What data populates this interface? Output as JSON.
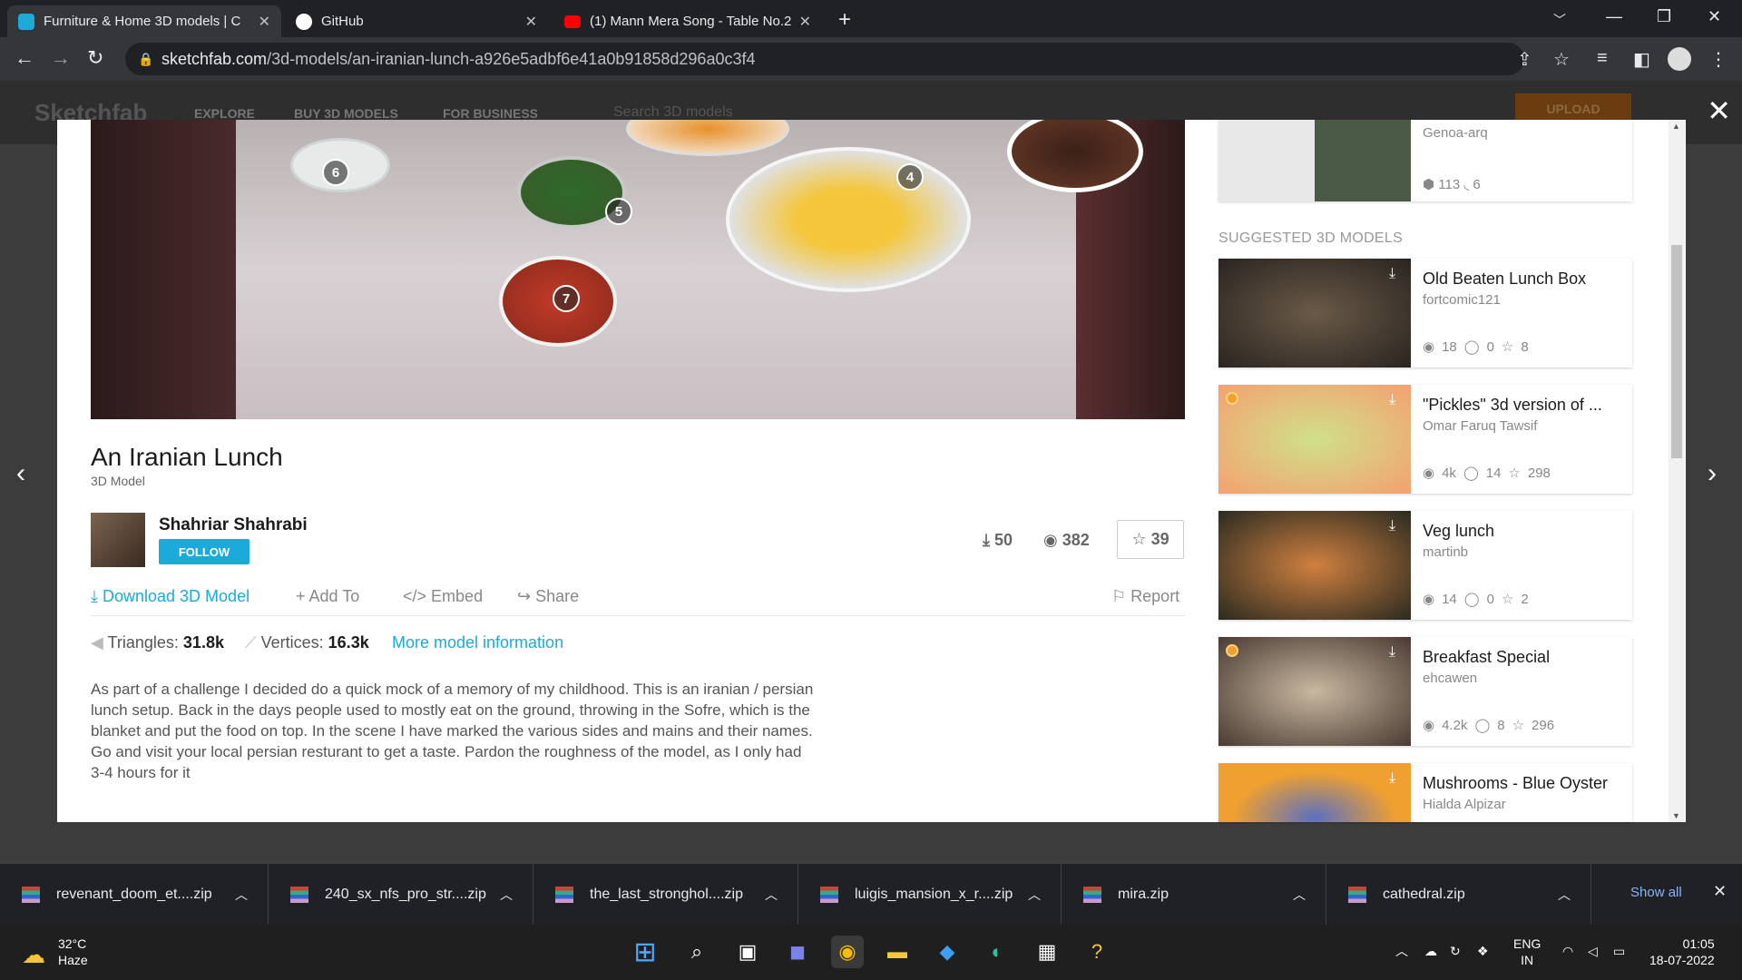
{
  "browser": {
    "tabs": [
      {
        "title": "Furniture & Home 3D models | C",
        "color": "#1caad9"
      },
      {
        "title": "GitHub",
        "color": "#ffffff"
      },
      {
        "title": "(1) Mann Mera Song - Table No.2",
        "color": "#ff0000"
      }
    ],
    "url_domain": "sketchfab.com",
    "url_path": "/3d-models/an-iranian-lunch-a926e5adbf6e41a0b91858d296a0c3f4"
  },
  "model": {
    "title": "An Iranian Lunch",
    "type": "3D Model",
    "author": "Shahriar Shahrabi",
    "follow_label": "FOLLOW",
    "downloads": "50",
    "views": "382",
    "likes": "39",
    "hotspots": [
      "6",
      "5",
      "4",
      "7"
    ],
    "actions": {
      "download": "Download 3D Model",
      "add_to": "Add To",
      "embed": "Embed",
      "share": "Share",
      "report": "Report"
    },
    "triangles_label": "Triangles:",
    "triangles": "31.8k",
    "vertices_label": "Vertices:",
    "vertices": "16.3k",
    "more_info": "More model information",
    "description": "As part of a challenge I decided do a quick mock of a memory of my childhood. This is an iranian / persian lunch setup. Back in the days people used to mostly eat on the ground, throwing in the Sofre, which is the blanket and put the food on top. In the scene I have marked the various sides and mains and their names. Go and visit your local persian resturant to get a taste. Pardon the roughness of the model, as I only had 3-4 hours for it"
  },
  "sidebar": {
    "top_card": {
      "author": "Genoa-arq",
      "models": "113",
      "followers": "6"
    },
    "suggested_heading": "SUGGESTED 3D MODELS",
    "cards": [
      {
        "title": "Old Beaten Lunch Box",
        "author": "fortcomic121",
        "views": "18",
        "comments": "0",
        "likes": "8",
        "staff": false
      },
      {
        "title": "\"Pickles\" 3d version of ...",
        "author": "Omar Faruq Tawsif",
        "views": "4k",
        "comments": "14",
        "likes": "298",
        "staff": true
      },
      {
        "title": "Veg lunch",
        "author": "martinb",
        "views": "14",
        "comments": "0",
        "likes": "2",
        "staff": false
      },
      {
        "title": "Breakfast Special",
        "author": "ehcawen",
        "views": "4.2k",
        "comments": "8",
        "likes": "296",
        "staff": true
      },
      {
        "title": "Mushrooms - Blue Oyster",
        "author": "Hialda Alpizar",
        "views": "",
        "comments": "",
        "likes": "",
        "staff": false
      }
    ]
  },
  "site_header": {
    "logo": "Sketchfab",
    "nav": [
      "EXPLORE",
      "BUY 3D MODELS",
      "FOR BUSINESS"
    ],
    "search_placeholder": "Search 3D models",
    "upload": "UPLOAD"
  },
  "downloads": [
    "revenant_doom_et....zip",
    "240_sx_nfs_pro_str....zip",
    "the_last_stronghol....zip",
    "luigis_mansion_x_r....zip",
    "mira.zip",
    "cathedral.zip"
  ],
  "show_all": "Show all",
  "taskbar": {
    "weather_temp": "32°C",
    "weather_desc": "Haze",
    "lang": "ENG",
    "region": "IN",
    "time": "01:05",
    "date": "18-07-2022"
  }
}
